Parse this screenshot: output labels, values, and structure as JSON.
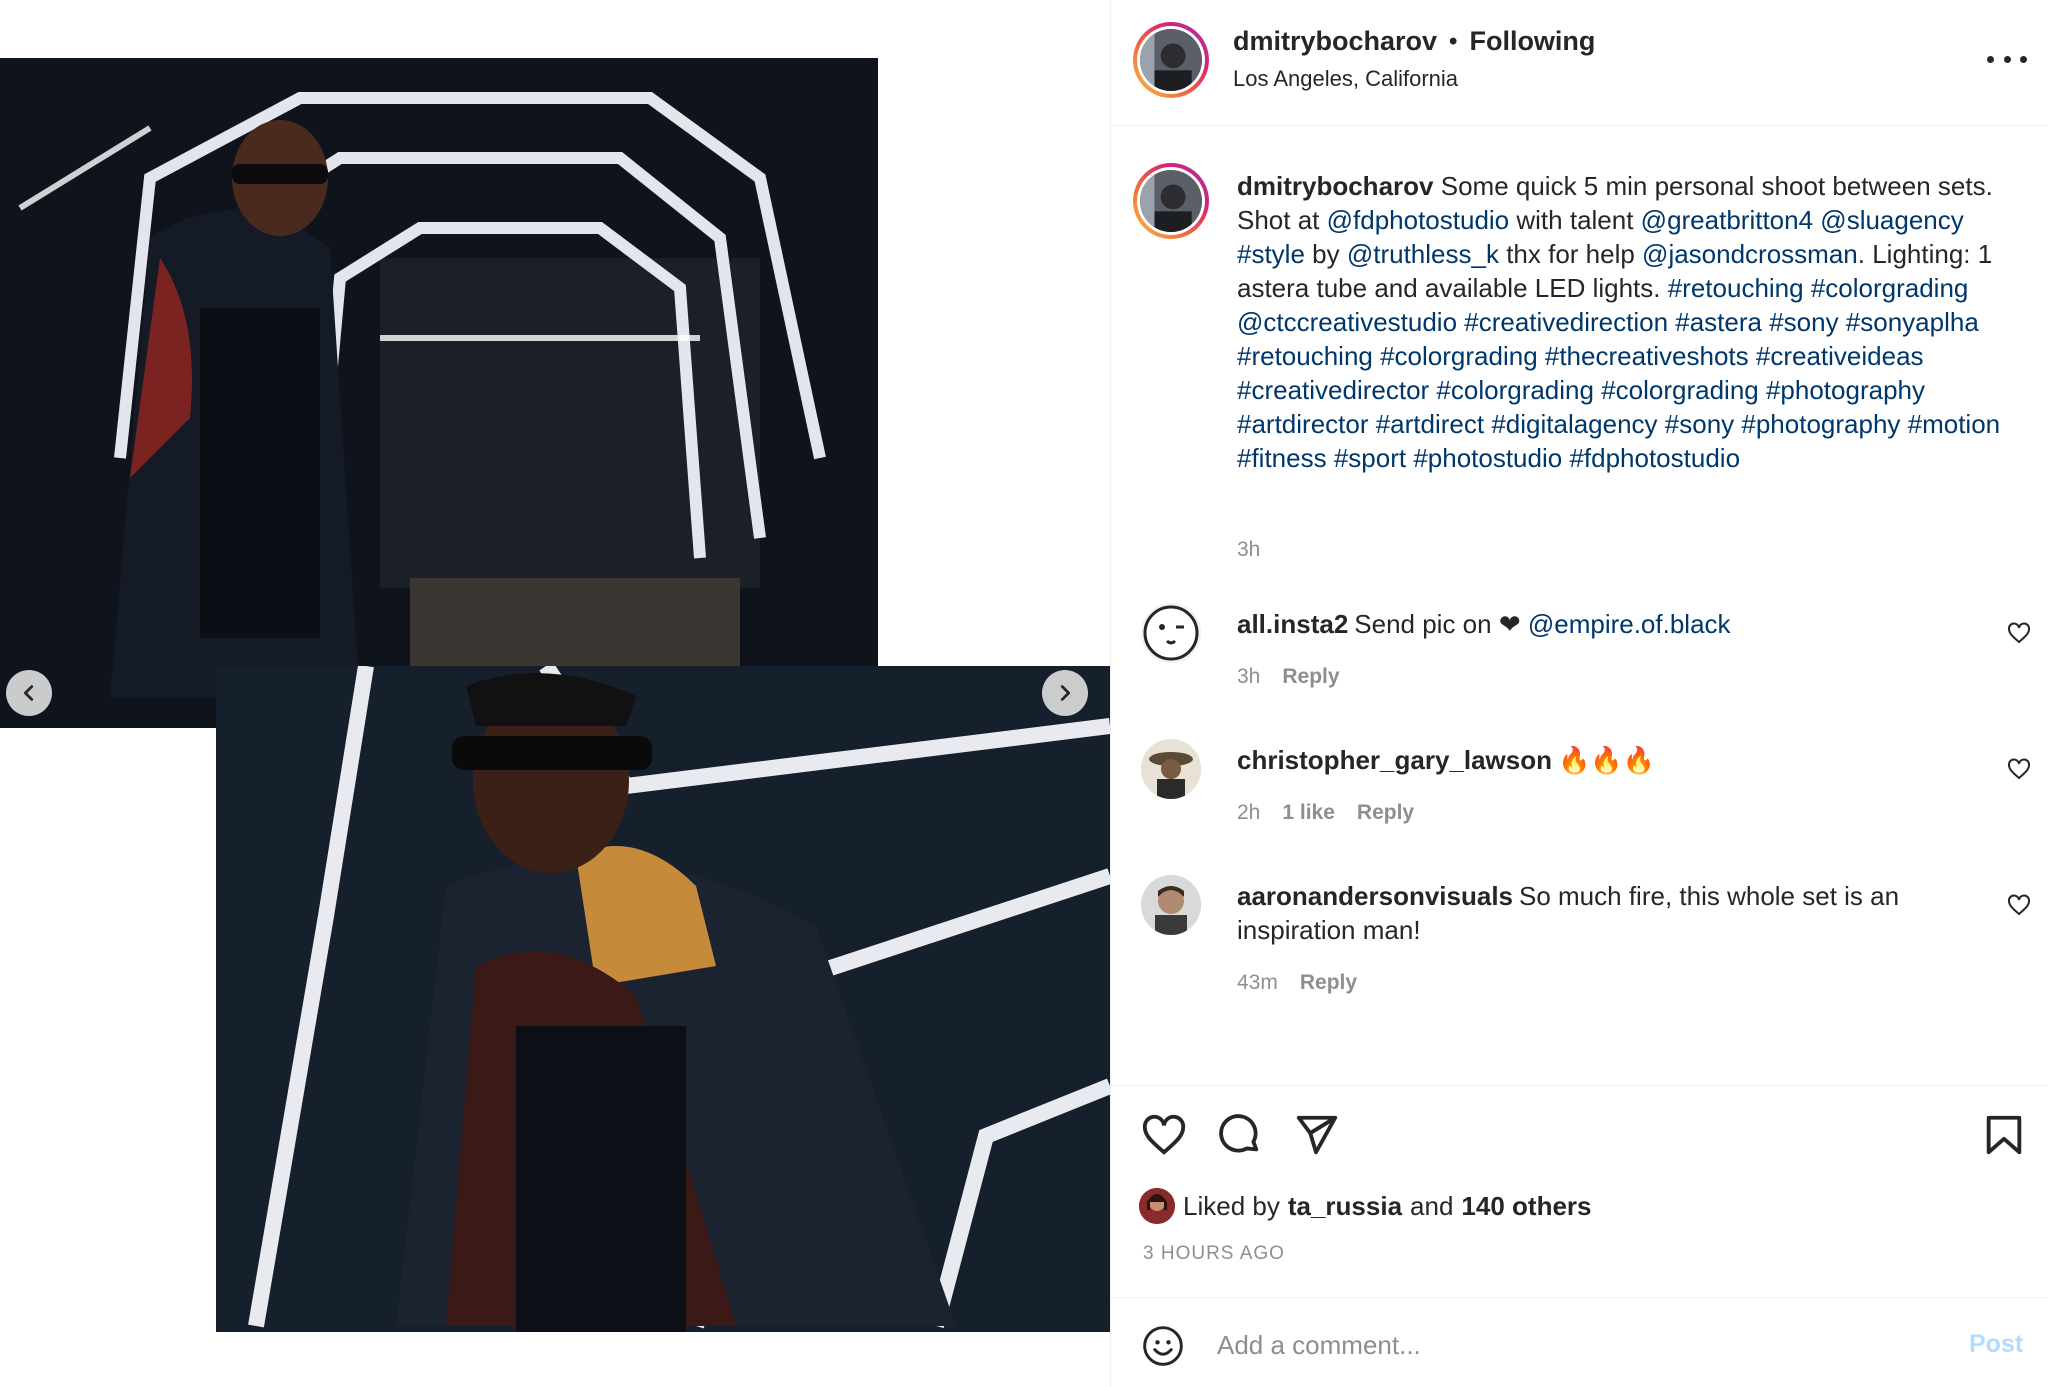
{
  "post": {
    "username": "dmitrybocharov",
    "separator": "•",
    "follow_status": "Following",
    "location": "Los Angeles, California",
    "more_icon": "more-horizontal-icon"
  },
  "caption": {
    "username": "dmitrybocharov",
    "parts": [
      {
        "t": "Some quick 5 min personal shoot between sets. Shot at ",
        "link": false
      },
      {
        "t": "@fdphotostudio",
        "link": true
      },
      {
        "t": " with talent ",
        "link": false
      },
      {
        "t": "@greatbritton4",
        "link": true
      },
      {
        "t": " ",
        "link": false
      },
      {
        "t": "@sluagency",
        "link": true
      },
      {
        "t": " ",
        "link": false
      },
      {
        "t": "#style",
        "link": true
      },
      {
        "t": " by ",
        "link": false
      },
      {
        "t": "@truthless_k",
        "link": true
      },
      {
        "t": " thx for help ",
        "link": false
      },
      {
        "t": "@jasondcrossman",
        "link": true
      },
      {
        "t": ". Lighting: 1 astera tube and available LED lights. ",
        "link": false
      },
      {
        "t": "#retouching #colorgrading @ctccreativestudio #creativedirection #astera #sony #sonyaplha #retouching #colorgrading #thecreativeshots #creativeideas #creativedirector #colorgrading #colorgrading #photography #artdirector #artdirect #digitalagency #sony #photography #motion #fitness #sport #photostudio #fdphotostudio",
        "link": true
      }
    ],
    "time": "3h"
  },
  "comments": [
    {
      "username": "all.insta2",
      "parts": [
        {
          "t": "Send pic on ❤ ",
          "link": false
        },
        {
          "t": "@empire.of.black",
          "link": true
        }
      ],
      "time": "3h",
      "likes": "",
      "reply": "Reply"
    },
    {
      "username": "christopher_gary_lawson",
      "parts": [
        {
          "t": "🔥🔥🔥",
          "link": false
        }
      ],
      "time": "2h",
      "likes": "1 like",
      "reply": "Reply"
    },
    {
      "username": "aaronandersonvisuals",
      "parts": [
        {
          "t": "So much fire, this whole set is an inspiration man!",
          "link": false
        }
      ],
      "time": "43m",
      "likes": "",
      "reply": "Reply"
    }
  ],
  "actions": {
    "like_icon": "heart-icon",
    "comment_icon": "comment-icon",
    "share_icon": "send-icon",
    "save_icon": "bookmark-icon"
  },
  "likes": {
    "prefix": "Liked by",
    "user": "ta_russia",
    "middle": "and",
    "others": "140 others"
  },
  "timestamp": "3 HOURS AGO",
  "add_comment": {
    "placeholder": "Add a comment...",
    "post_label": "Post",
    "emoji_icon": "smiley-icon"
  },
  "colors": {
    "link": "#00376b",
    "secondary_text": "#8e8e8e",
    "post_disabled": "#b3dbff"
  }
}
